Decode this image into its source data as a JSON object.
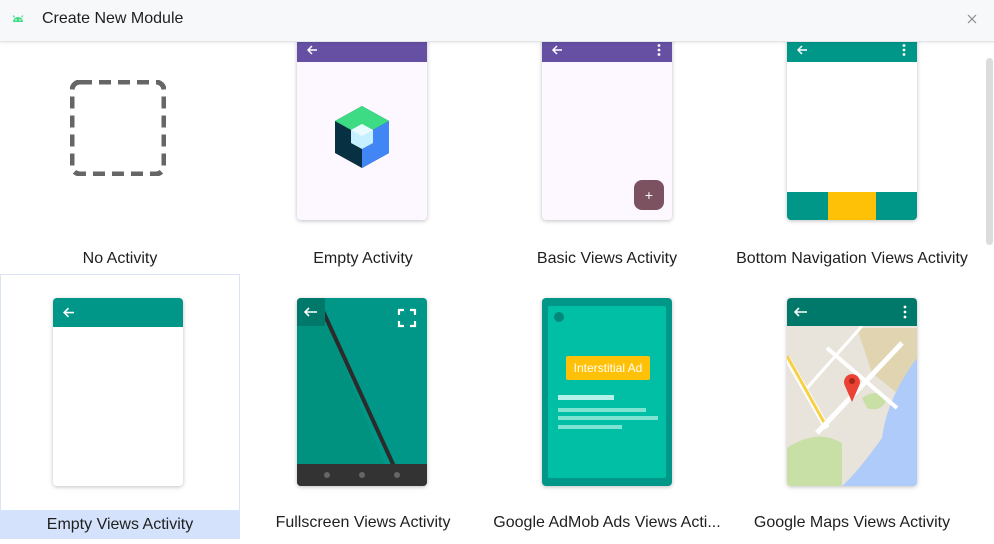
{
  "window": {
    "title": "Create New Module"
  },
  "templates": [
    {
      "label": "No Activity"
    },
    {
      "label": "Empty Activity"
    },
    {
      "label": "Basic Views Activity",
      "fab_symbol": "+"
    },
    {
      "label": "Bottom Navigation Views Activity"
    },
    {
      "label": "Empty Views Activity",
      "selected": true
    },
    {
      "label": "Fullscreen Views Activity"
    },
    {
      "label": "Google AdMob Ads Views Acti...",
      "ad_label": "Interstitial Ad"
    },
    {
      "label": "Google Maps Views Activity"
    }
  ],
  "icons": {
    "app": "android-icon",
    "close": "close-icon",
    "back": "back-arrow-icon",
    "overflow": "overflow-menu-icon",
    "fullscreen": "fullscreen-icon",
    "map_pin": "map-pin-icon",
    "compose": "jetpack-compose-logo"
  },
  "colors": {
    "purple_appbar": "#6650a4",
    "teal_appbar": "#009688",
    "teal_dark": "#00796b",
    "amber": "#ffc107",
    "fab": "#7d5260",
    "selection": "#d4e2fb",
    "ad_green": "#00bfa5"
  }
}
